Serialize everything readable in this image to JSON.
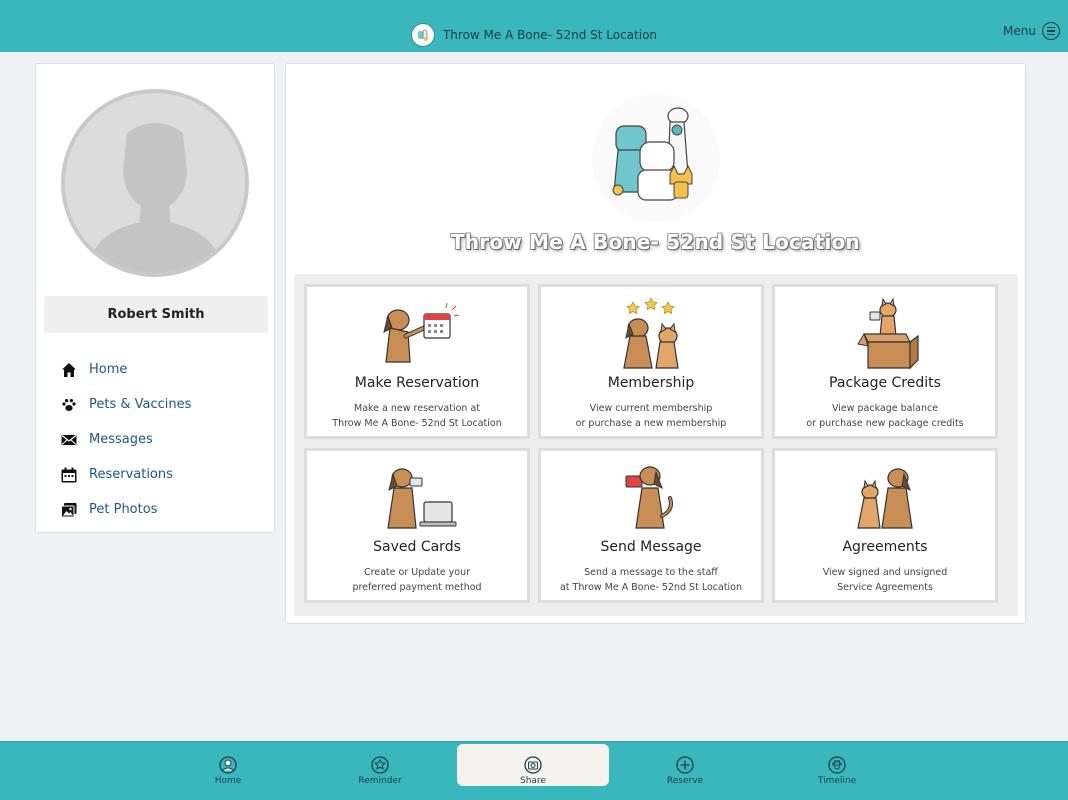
{
  "header": {
    "title": "Throw Me A Bone- 52nd St Location",
    "menu_label": "Menu"
  },
  "profile": {
    "name": "Robert Smith"
  },
  "sidebar": {
    "items": [
      {
        "label": "Home",
        "icon": "home-icon"
      },
      {
        "label": "Pets & Vaccines",
        "icon": "paw-icon"
      },
      {
        "label": "Messages",
        "icon": "envelope-icon"
      },
      {
        "label": "Reservations",
        "icon": "calendar-icon"
      },
      {
        "label": "Pet Photos",
        "icon": "photos-icon"
      }
    ]
  },
  "main": {
    "business_title": "Throw Me A Bone- 52nd St Location",
    "tiles": [
      {
        "title": "Make Reservation",
        "desc1": "Make a new reservation at",
        "desc2": "Throw Me A Bone- 52nd St Location"
      },
      {
        "title": "Membership",
        "desc1": "View current membership",
        "desc2": "or purchase a new membership"
      },
      {
        "title": "Package Credits",
        "desc1": "View package balance",
        "desc2": "or purchase new package credits"
      },
      {
        "title": "Saved Cards",
        "desc1": "Create or Update your",
        "desc2": "preferred payment method"
      },
      {
        "title": "Send Message",
        "desc1": "Send a message to the staff",
        "desc2": "at Throw Me A Bone- 52nd St Location"
      },
      {
        "title": "Agreements",
        "desc1": "View signed and unsigned",
        "desc2": "Service Agreements"
      }
    ]
  },
  "tabbar": {
    "items": [
      {
        "label": "Home",
        "icon": "user-circle-icon"
      },
      {
        "label": "Reminder",
        "icon": "star-icon"
      },
      {
        "label": "Share",
        "icon": "camera-icon",
        "active": true
      },
      {
        "label": "Reserve",
        "icon": "plus-circle-icon"
      },
      {
        "label": "Timeline",
        "icon": "paw-circle-icon"
      }
    ]
  },
  "colors": {
    "accent": "#3ab7bd",
    "link": "#1d5590",
    "dog": "#c98e55"
  }
}
